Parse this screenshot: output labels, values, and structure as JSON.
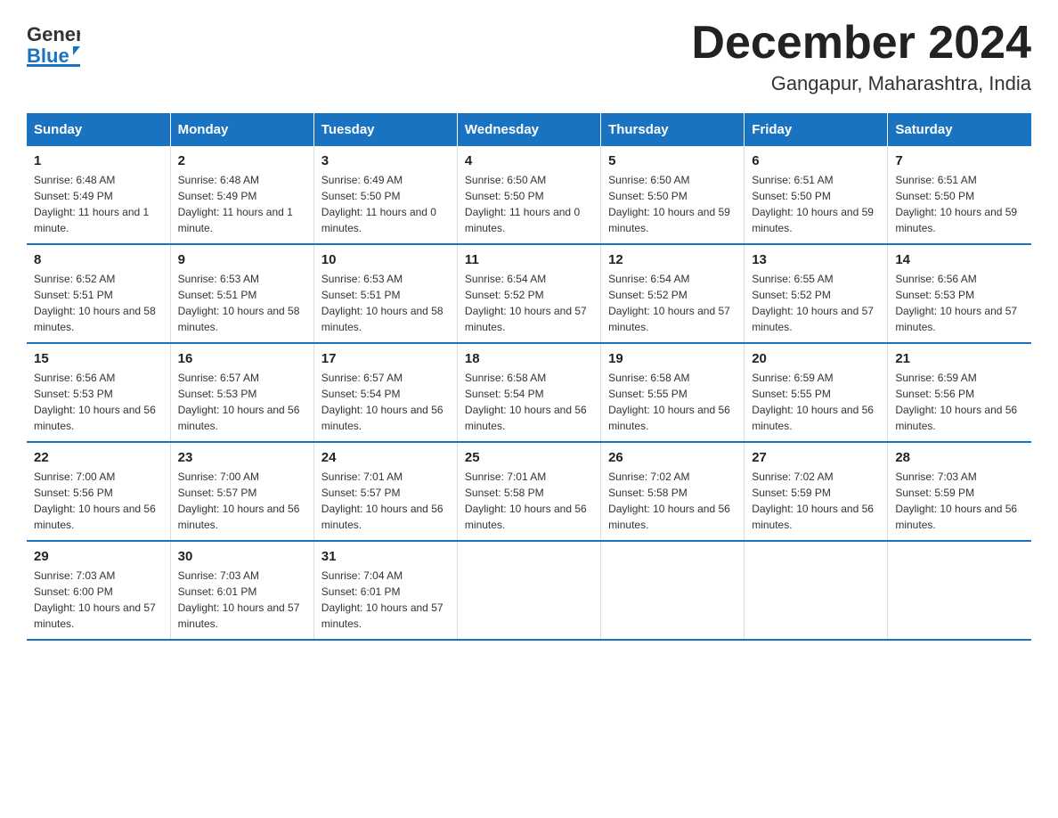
{
  "header": {
    "title": "December 2024",
    "subtitle": "Gangapur, Maharashtra, India",
    "logo_general": "General",
    "logo_blue": "Blue"
  },
  "weekdays": [
    "Sunday",
    "Monday",
    "Tuesday",
    "Wednesday",
    "Thursday",
    "Friday",
    "Saturday"
  ],
  "weeks": [
    [
      {
        "day": "1",
        "sunrise": "6:48 AM",
        "sunset": "5:49 PM",
        "daylight": "11 hours and 1 minute."
      },
      {
        "day": "2",
        "sunrise": "6:48 AM",
        "sunset": "5:49 PM",
        "daylight": "11 hours and 1 minute."
      },
      {
        "day": "3",
        "sunrise": "6:49 AM",
        "sunset": "5:50 PM",
        "daylight": "11 hours and 0 minutes."
      },
      {
        "day": "4",
        "sunrise": "6:50 AM",
        "sunset": "5:50 PM",
        "daylight": "11 hours and 0 minutes."
      },
      {
        "day": "5",
        "sunrise": "6:50 AM",
        "sunset": "5:50 PM",
        "daylight": "10 hours and 59 minutes."
      },
      {
        "day": "6",
        "sunrise": "6:51 AM",
        "sunset": "5:50 PM",
        "daylight": "10 hours and 59 minutes."
      },
      {
        "day": "7",
        "sunrise": "6:51 AM",
        "sunset": "5:50 PM",
        "daylight": "10 hours and 59 minutes."
      }
    ],
    [
      {
        "day": "8",
        "sunrise": "6:52 AM",
        "sunset": "5:51 PM",
        "daylight": "10 hours and 58 minutes."
      },
      {
        "day": "9",
        "sunrise": "6:53 AM",
        "sunset": "5:51 PM",
        "daylight": "10 hours and 58 minutes."
      },
      {
        "day": "10",
        "sunrise": "6:53 AM",
        "sunset": "5:51 PM",
        "daylight": "10 hours and 58 minutes."
      },
      {
        "day": "11",
        "sunrise": "6:54 AM",
        "sunset": "5:52 PM",
        "daylight": "10 hours and 57 minutes."
      },
      {
        "day": "12",
        "sunrise": "6:54 AM",
        "sunset": "5:52 PM",
        "daylight": "10 hours and 57 minutes."
      },
      {
        "day": "13",
        "sunrise": "6:55 AM",
        "sunset": "5:52 PM",
        "daylight": "10 hours and 57 minutes."
      },
      {
        "day": "14",
        "sunrise": "6:56 AM",
        "sunset": "5:53 PM",
        "daylight": "10 hours and 57 minutes."
      }
    ],
    [
      {
        "day": "15",
        "sunrise": "6:56 AM",
        "sunset": "5:53 PM",
        "daylight": "10 hours and 56 minutes."
      },
      {
        "day": "16",
        "sunrise": "6:57 AM",
        "sunset": "5:53 PM",
        "daylight": "10 hours and 56 minutes."
      },
      {
        "day": "17",
        "sunrise": "6:57 AM",
        "sunset": "5:54 PM",
        "daylight": "10 hours and 56 minutes."
      },
      {
        "day": "18",
        "sunrise": "6:58 AM",
        "sunset": "5:54 PM",
        "daylight": "10 hours and 56 minutes."
      },
      {
        "day": "19",
        "sunrise": "6:58 AM",
        "sunset": "5:55 PM",
        "daylight": "10 hours and 56 minutes."
      },
      {
        "day": "20",
        "sunrise": "6:59 AM",
        "sunset": "5:55 PM",
        "daylight": "10 hours and 56 minutes."
      },
      {
        "day": "21",
        "sunrise": "6:59 AM",
        "sunset": "5:56 PM",
        "daylight": "10 hours and 56 minutes."
      }
    ],
    [
      {
        "day": "22",
        "sunrise": "7:00 AM",
        "sunset": "5:56 PM",
        "daylight": "10 hours and 56 minutes."
      },
      {
        "day": "23",
        "sunrise": "7:00 AM",
        "sunset": "5:57 PM",
        "daylight": "10 hours and 56 minutes."
      },
      {
        "day": "24",
        "sunrise": "7:01 AM",
        "sunset": "5:57 PM",
        "daylight": "10 hours and 56 minutes."
      },
      {
        "day": "25",
        "sunrise": "7:01 AM",
        "sunset": "5:58 PM",
        "daylight": "10 hours and 56 minutes."
      },
      {
        "day": "26",
        "sunrise": "7:02 AM",
        "sunset": "5:58 PM",
        "daylight": "10 hours and 56 minutes."
      },
      {
        "day": "27",
        "sunrise": "7:02 AM",
        "sunset": "5:59 PM",
        "daylight": "10 hours and 56 minutes."
      },
      {
        "day": "28",
        "sunrise": "7:03 AM",
        "sunset": "5:59 PM",
        "daylight": "10 hours and 56 minutes."
      }
    ],
    [
      {
        "day": "29",
        "sunrise": "7:03 AM",
        "sunset": "6:00 PM",
        "daylight": "10 hours and 57 minutes."
      },
      {
        "day": "30",
        "sunrise": "7:03 AM",
        "sunset": "6:01 PM",
        "daylight": "10 hours and 57 minutes."
      },
      {
        "day": "31",
        "sunrise": "7:04 AM",
        "sunset": "6:01 PM",
        "daylight": "10 hours and 57 minutes."
      },
      null,
      null,
      null,
      null
    ]
  ],
  "labels": {
    "sunrise": "Sunrise:",
    "sunset": "Sunset:",
    "daylight": "Daylight:"
  }
}
